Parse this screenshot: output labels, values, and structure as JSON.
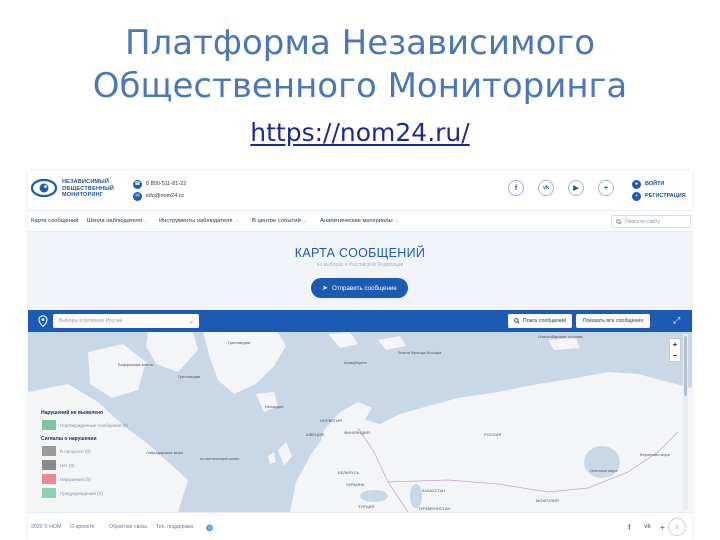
{
  "slide": {
    "title_line1": "Платформа Независимого",
    "title_line2": "Общественного Мониторинга",
    "url": "https://nom24.ru/"
  },
  "header": {
    "logo_text": "НЕЗАВИСИМЫЙ\nОБЩЕСТВЕННЫЙ\nМОНИТОРИНГ",
    "phone": "8 800-511-81-22",
    "email": "info@nom24.ru",
    "social_icons": [
      "facebook-icon",
      "vk-icon",
      "youtube-icon",
      "plus-icon"
    ],
    "login_label": "ВОЙТИ",
    "register_label": "РЕГИСТРАЦИЯ"
  },
  "nav": {
    "items": [
      {
        "label": "Карта сообщений",
        "has_dropdown": false
      },
      {
        "label": "Школа наблюдателя",
        "has_dropdown": true
      },
      {
        "label": "Инструменты наблюдателя",
        "has_dropdown": true
      },
      {
        "label": "В центре событий",
        "has_dropdown": true
      },
      {
        "label": "Аналитические материалы",
        "has_dropdown": true
      }
    ],
    "search_placeholder": "Поиск по сайту"
  },
  "hero": {
    "title": "КАРТА СООБЩЕНИЙ",
    "subtitle": "на выборах в Российской Федерации",
    "send_button": "Отправить сообщение"
  },
  "map": {
    "region_placeholder": "Выборы в регионах России",
    "search_button": "Поиск сообщений",
    "show_all_button": "Показать все сообщения",
    "zoom_in": "+",
    "zoom_out": "−",
    "labels": {
      "greenland": "Гренландия",
      "svalbard": "Шпицберген",
      "franz_josef": "Земля Франца-Иосифа",
      "new_siberian": "Новосибирские острова",
      "baffin": "Баффинова земля",
      "norway": "НОРВЕГИЯ",
      "iceland": "Исландия",
      "sweden": "ШВЕЦИЯ",
      "finland": "ФИНЛЯНДИЯ",
      "russia": "РОССИЯ",
      "belarus": "БЕЛАРУСЬ",
      "kazakhstan": "КАЗАХСТАН",
      "turkey": "ТУРЦИЯ",
      "mongolia": "МОНГОЛИЯ",
      "ukraine": "УКРАИНА",
      "atlantic": "Атлантический океан",
      "labrador": "Лабрадорское море",
      "okhotsk": "Охотское море",
      "bering": "Берингово море",
      "turkmenistan": "ТУРКМЕНИСТАН"
    },
    "legend": {
      "heading_none": "Нарушений не выявлено",
      "heading_signals": "Сигналы о нарушении",
      "rows": [
        {
          "label": "Подтвержденные сообщения (0)",
          "color": "#7ec3a3"
        },
        {
          "label": "В процессе (0)",
          "color": "#9a9a9a"
        },
        {
          "label": "Нет (0)",
          "color": "#8a8a8a"
        },
        {
          "label": "Нарушения (0)",
          "color": "#e88a96"
        },
        {
          "label": "Предупреждения (0)",
          "color": "#8fd0b4"
        }
      ]
    }
  },
  "footer": {
    "copyright": "2020 © НОМ",
    "about": "О проекте",
    "feedback": "Обратная связь",
    "support": "Тех. поддержка"
  },
  "colors": {
    "brand_blue": "#1d5ab3",
    "title_blue": "#4b77b4",
    "url_blue": "#1f2a8a",
    "map_water": "#c9d8e6",
    "map_land": "#f3f5f7"
  }
}
